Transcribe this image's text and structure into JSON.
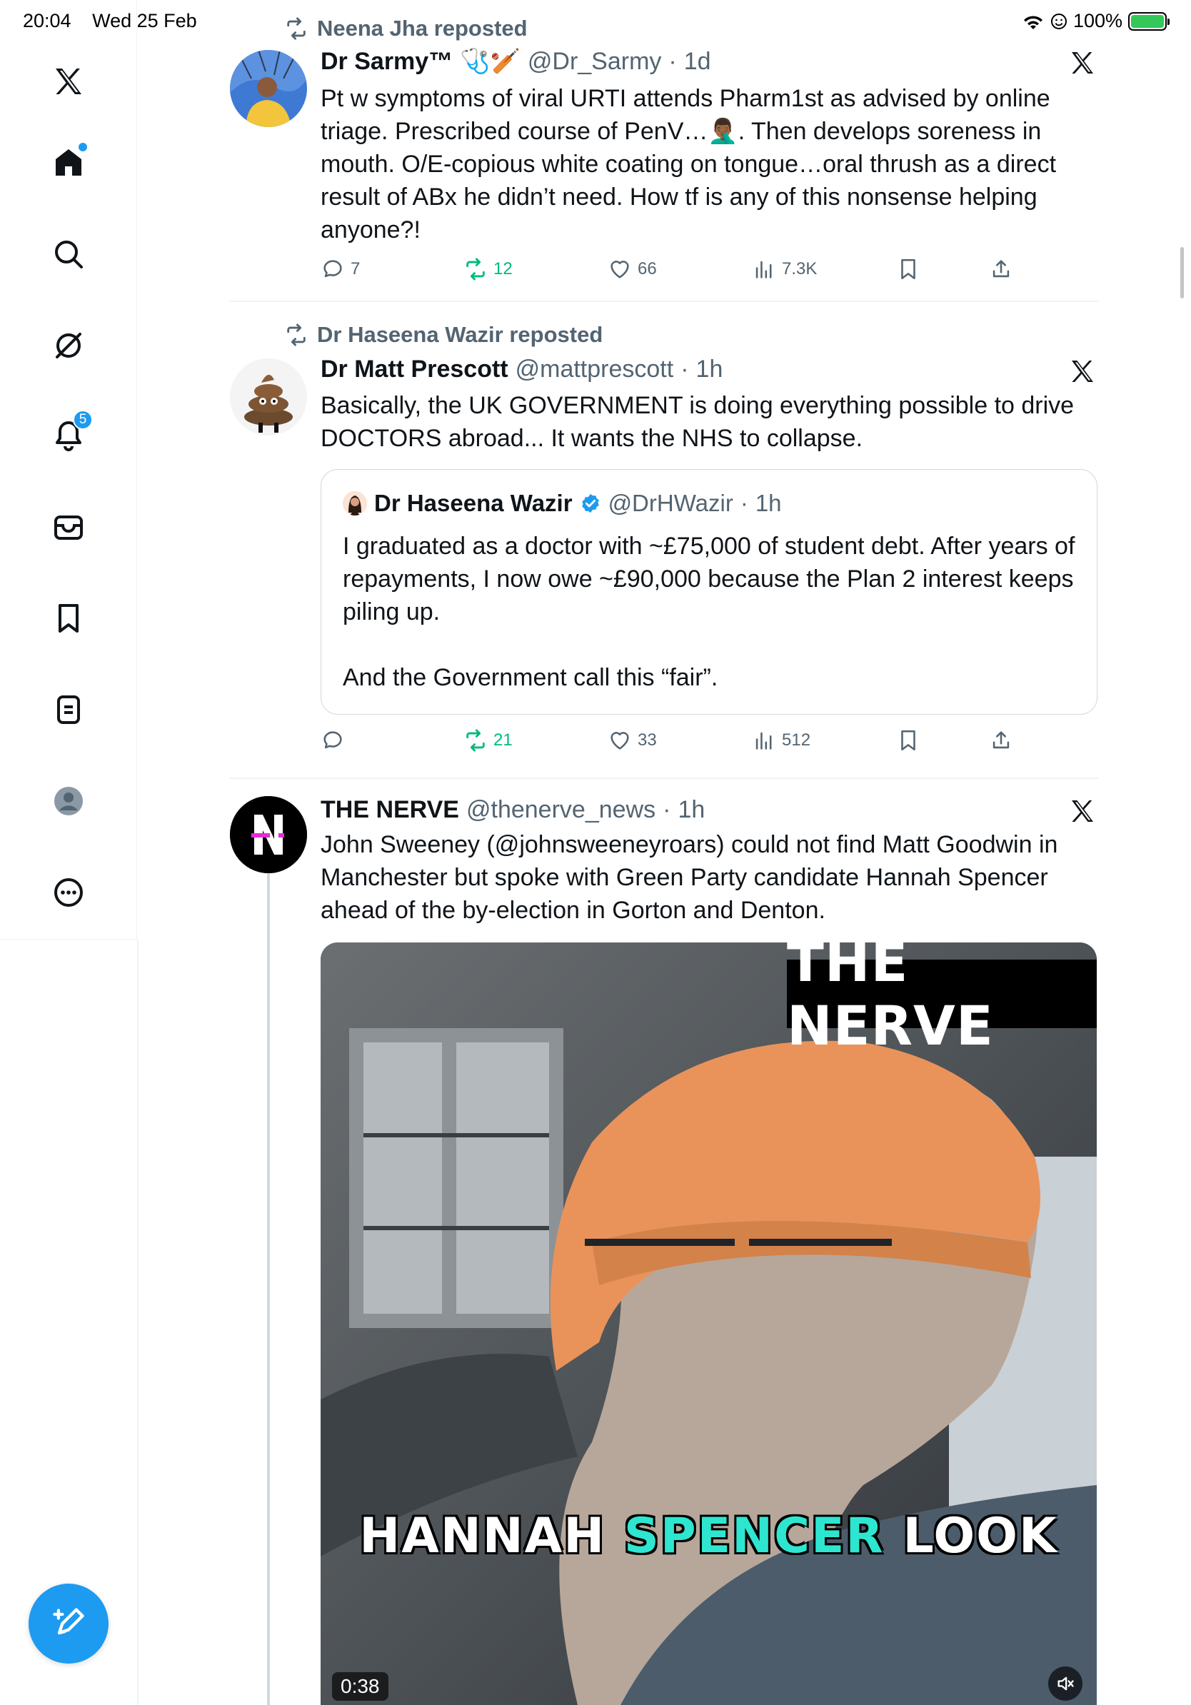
{
  "status_bar": {
    "time": "20:04",
    "date": "Wed 25 Feb",
    "battery": "100%"
  },
  "sidebar": {
    "items": [
      {
        "name": "x-logo"
      },
      {
        "name": "home",
        "has_dot": true
      },
      {
        "name": "search"
      },
      {
        "name": "grok"
      },
      {
        "name": "notifications",
        "badge": "5"
      },
      {
        "name": "messages"
      },
      {
        "name": "bookmarks"
      },
      {
        "name": "lists"
      },
      {
        "name": "profile"
      },
      {
        "name": "more"
      }
    ],
    "compose": "compose"
  },
  "posts": [
    {
      "repost_by": "Neena Jha reposted",
      "name": "Dr Sarmy™",
      "name_emoji": "🩺🏏",
      "handle": "@Dr_Sarmy",
      "time": "1d",
      "text": "Pt w symptoms of viral URTI attends Pharm1st as advised by online triage. Prescribed course of PenV…🤦🏾‍♂️. Then develops soreness in mouth. O/E-copious white coating on tongue…oral thrush as a direct result of ABx he didn’t need. How tf is any of this nonsense helping anyone?!",
      "stats": {
        "replies": "7",
        "reposts": "12",
        "likes": "66",
        "views": "7.3K"
      }
    },
    {
      "repost_by": "Dr Haseena Wazir reposted",
      "name": "Dr Matt Prescott",
      "handle": "@mattprescott",
      "time": "1h",
      "text": "Basically, the UK GOVERNMENT is doing everything possible to drive DOCTORS abroad... It wants the NHS to collapse.",
      "quote": {
        "name": "Dr Haseena Wazir",
        "handle": "@DrHWazir",
        "time": "1h",
        "text": "I graduated as a doctor with ~£75,000 of student debt. After years of repayments, I now owe ~£90,000 because the Plan 2 interest keeps piling up.\n\nAnd the Government call this “fair”."
      },
      "stats": {
        "replies": "",
        "reposts": "21",
        "likes": "33",
        "views": "512"
      }
    },
    {
      "name": "THE NERVE",
      "handle": "@thenerve_news",
      "time": "1h",
      "text": "John Sweeney (@johnsweeneyroars) could not find Matt Goodwin in Manchester but spoke with Green Party candidate Hannah Spencer ahead of the by-election in Gorton and Denton.",
      "video": {
        "brand": "THE NERVE",
        "caption_a": "HANNAH",
        "caption_b": "SPENCER",
        "caption_c": "LOOK",
        "duration": "0:38"
      }
    }
  ],
  "colors": {
    "accent": "#1d9bf0",
    "repost_green": "#00ba7c",
    "muted": "#536471"
  }
}
